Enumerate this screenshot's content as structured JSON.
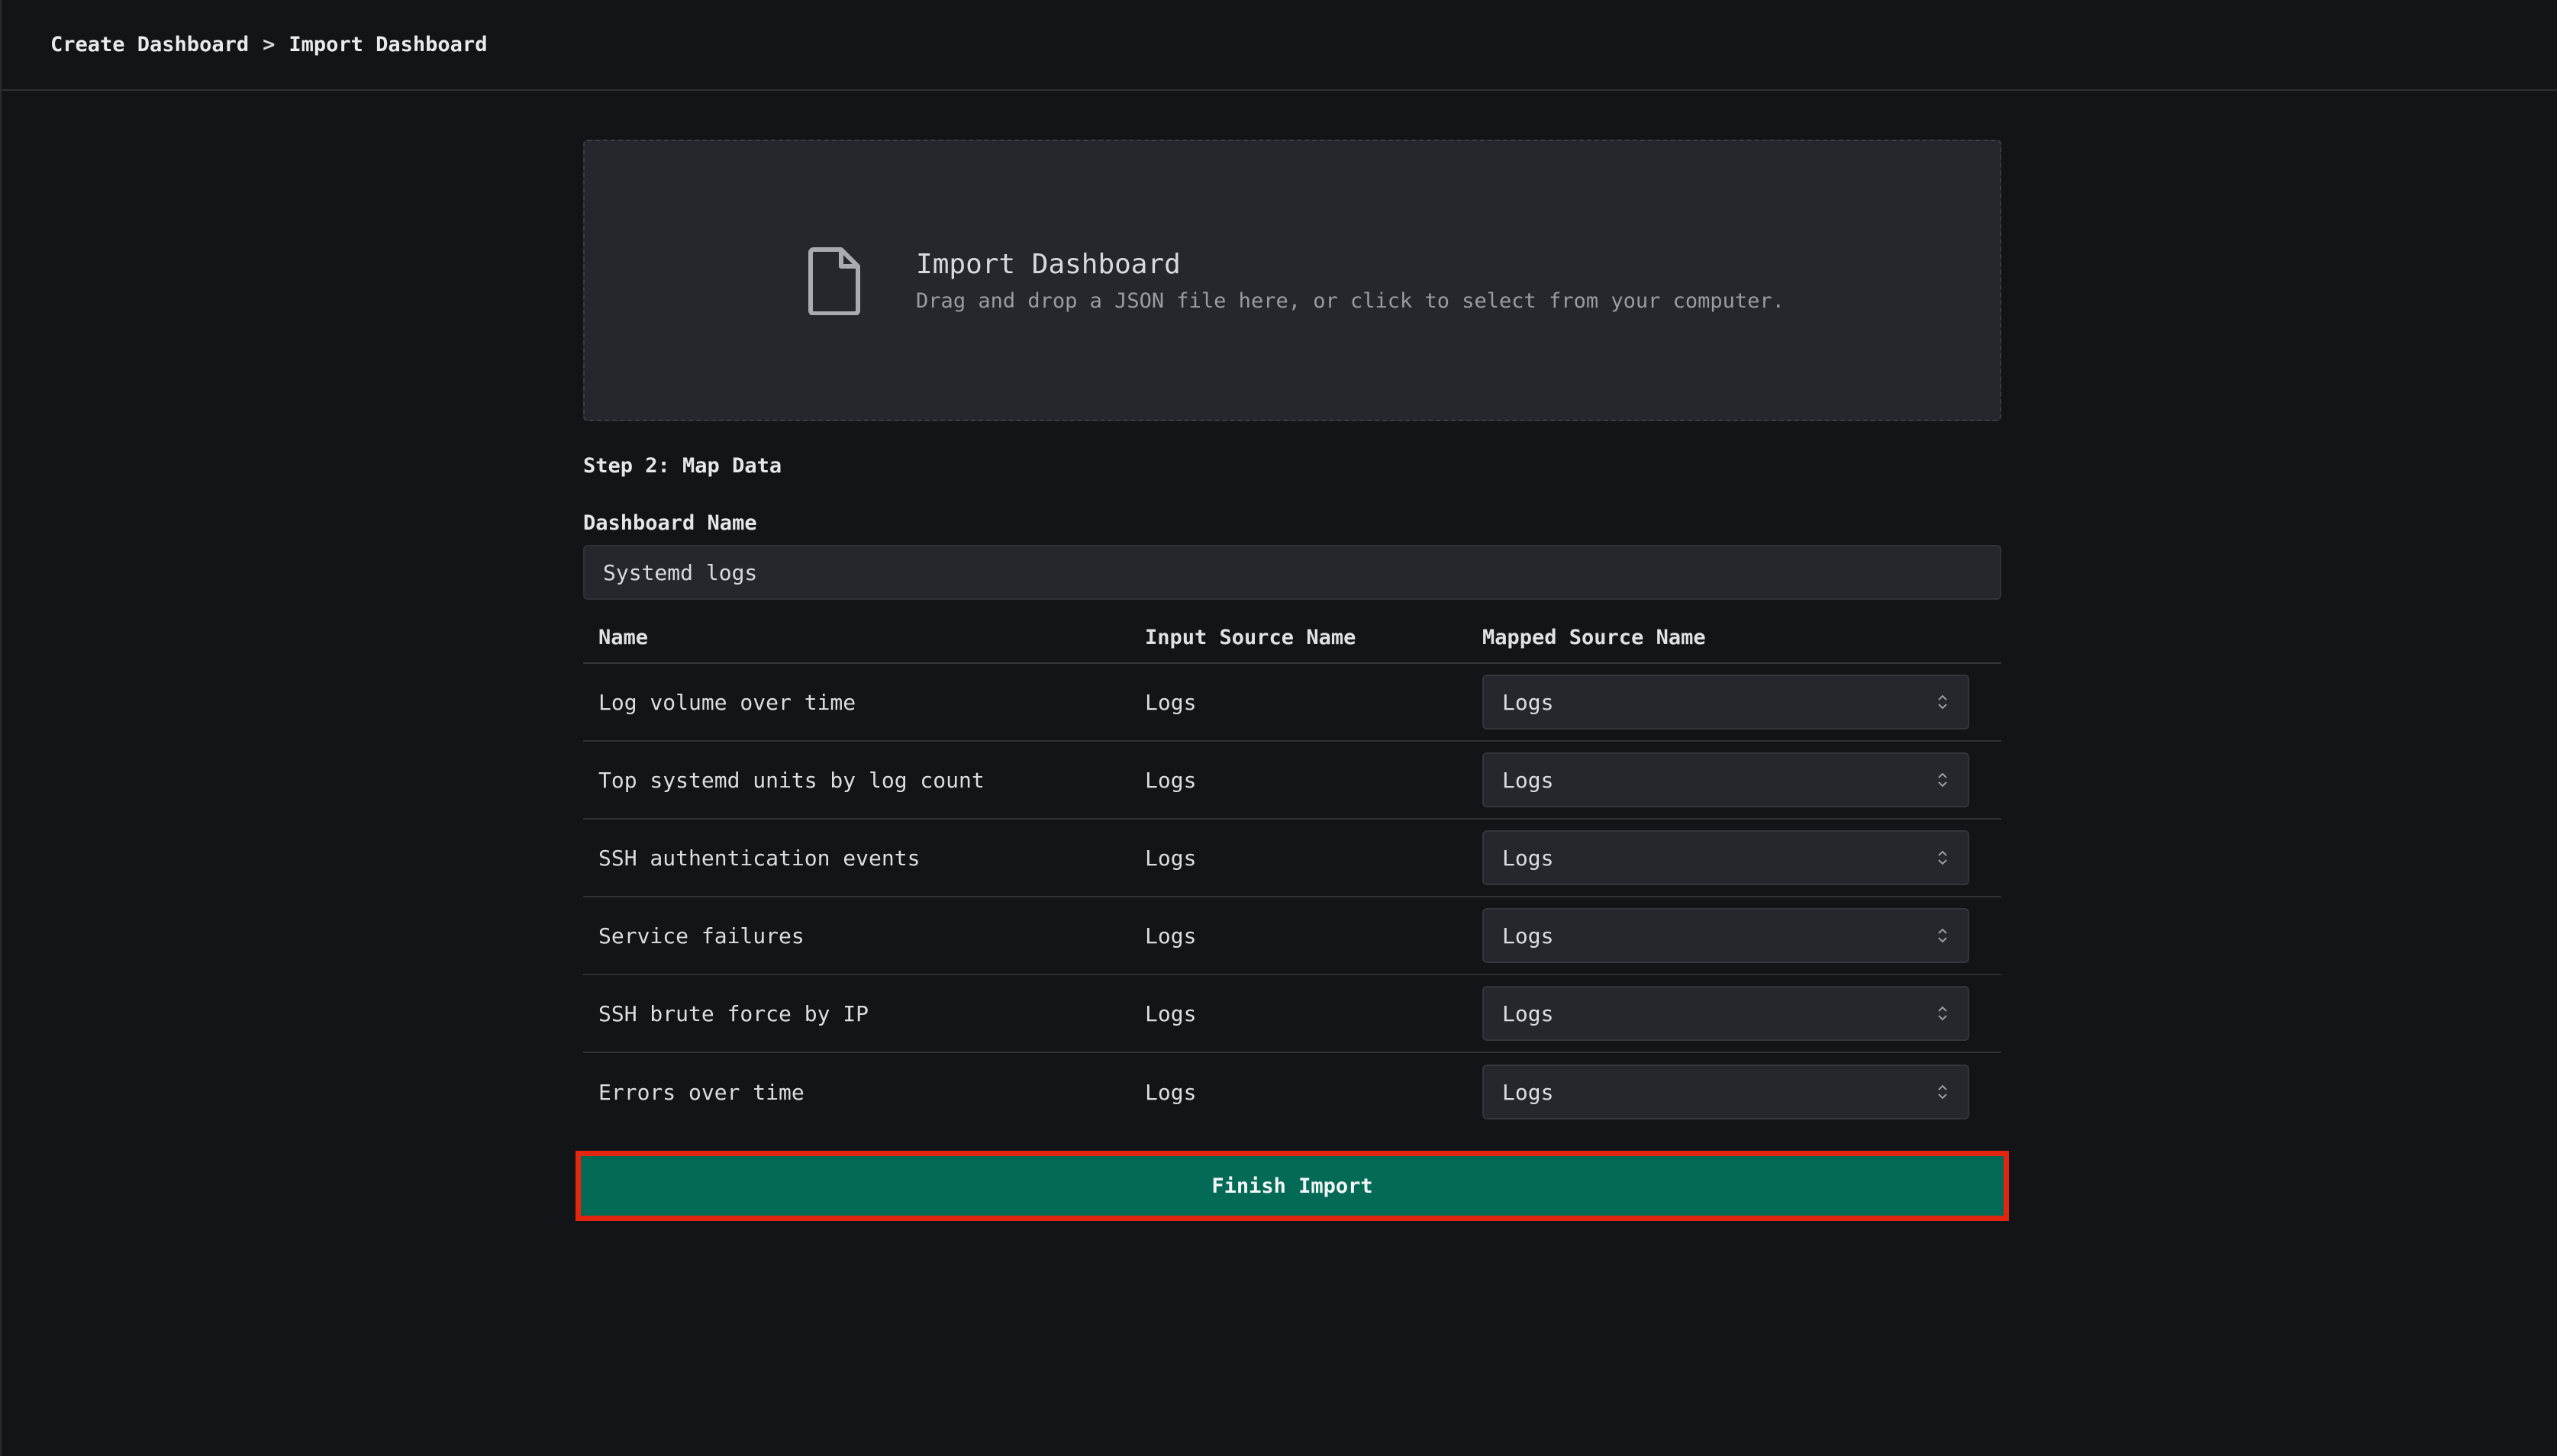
{
  "breadcrumb": {
    "items": [
      "Create Dashboard",
      "Import Dashboard"
    ],
    "separator": ">"
  },
  "dropzone": {
    "icon": "file-icon",
    "title": "Import Dashboard",
    "subtitle": "Drag and drop a JSON file here, or click to select from your computer."
  },
  "step": {
    "title": "Step 2: Map Data",
    "dashboard_name_label": "Dashboard Name",
    "dashboard_name_value": "Systemd logs"
  },
  "table": {
    "headers": [
      "Name",
      "Input Source Name",
      "Mapped Source Name"
    ],
    "rows": [
      {
        "name": "Log volume over time",
        "input": "Logs",
        "mapped": "Logs"
      },
      {
        "name": "Top systemd units by log count",
        "input": "Logs",
        "mapped": "Logs"
      },
      {
        "name": "SSH authentication events",
        "input": "Logs",
        "mapped": "Logs"
      },
      {
        "name": "Service failures",
        "input": "Logs",
        "mapped": "Logs"
      },
      {
        "name": "SSH brute force by IP",
        "input": "Logs",
        "mapped": "Logs"
      },
      {
        "name": "Errors over time",
        "input": "Logs",
        "mapped": "Logs"
      }
    ]
  },
  "actions": {
    "finish_label": "Finish Import"
  },
  "colors": {
    "background": "#131417",
    "panel": "#26272c",
    "primary_button": "#036b55",
    "highlight": "#e3260f"
  }
}
